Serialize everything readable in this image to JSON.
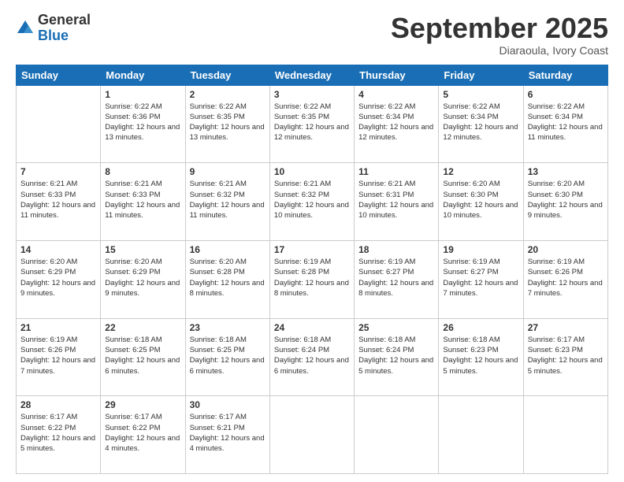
{
  "logo": {
    "general": "General",
    "blue": "Blue"
  },
  "header": {
    "month": "September 2025",
    "location": "Diaraoula, Ivory Coast"
  },
  "weekdays": [
    "Sunday",
    "Monday",
    "Tuesday",
    "Wednesday",
    "Thursday",
    "Friday",
    "Saturday"
  ],
  "weeks": [
    [
      {
        "day": "",
        "sunrise": "",
        "sunset": "",
        "daylight": ""
      },
      {
        "day": "1",
        "sunrise": "Sunrise: 6:22 AM",
        "sunset": "Sunset: 6:36 PM",
        "daylight": "Daylight: 12 hours and 13 minutes."
      },
      {
        "day": "2",
        "sunrise": "Sunrise: 6:22 AM",
        "sunset": "Sunset: 6:35 PM",
        "daylight": "Daylight: 12 hours and 13 minutes."
      },
      {
        "day": "3",
        "sunrise": "Sunrise: 6:22 AM",
        "sunset": "Sunset: 6:35 PM",
        "daylight": "Daylight: 12 hours and 12 minutes."
      },
      {
        "day": "4",
        "sunrise": "Sunrise: 6:22 AM",
        "sunset": "Sunset: 6:34 PM",
        "daylight": "Daylight: 12 hours and 12 minutes."
      },
      {
        "day": "5",
        "sunrise": "Sunrise: 6:22 AM",
        "sunset": "Sunset: 6:34 PM",
        "daylight": "Daylight: 12 hours and 12 minutes."
      },
      {
        "day": "6",
        "sunrise": "Sunrise: 6:22 AM",
        "sunset": "Sunset: 6:34 PM",
        "daylight": "Daylight: 12 hours and 11 minutes."
      }
    ],
    [
      {
        "day": "7",
        "sunrise": "Sunrise: 6:21 AM",
        "sunset": "Sunset: 6:33 PM",
        "daylight": "Daylight: 12 hours and 11 minutes."
      },
      {
        "day": "8",
        "sunrise": "Sunrise: 6:21 AM",
        "sunset": "Sunset: 6:33 PM",
        "daylight": "Daylight: 12 hours and 11 minutes."
      },
      {
        "day": "9",
        "sunrise": "Sunrise: 6:21 AM",
        "sunset": "Sunset: 6:32 PM",
        "daylight": "Daylight: 12 hours and 11 minutes."
      },
      {
        "day": "10",
        "sunrise": "Sunrise: 6:21 AM",
        "sunset": "Sunset: 6:32 PM",
        "daylight": "Daylight: 12 hours and 10 minutes."
      },
      {
        "day": "11",
        "sunrise": "Sunrise: 6:21 AM",
        "sunset": "Sunset: 6:31 PM",
        "daylight": "Daylight: 12 hours and 10 minutes."
      },
      {
        "day": "12",
        "sunrise": "Sunrise: 6:20 AM",
        "sunset": "Sunset: 6:30 PM",
        "daylight": "Daylight: 12 hours and 10 minutes."
      },
      {
        "day": "13",
        "sunrise": "Sunrise: 6:20 AM",
        "sunset": "Sunset: 6:30 PM",
        "daylight": "Daylight: 12 hours and 9 minutes."
      }
    ],
    [
      {
        "day": "14",
        "sunrise": "Sunrise: 6:20 AM",
        "sunset": "Sunset: 6:29 PM",
        "daylight": "Daylight: 12 hours and 9 minutes."
      },
      {
        "day": "15",
        "sunrise": "Sunrise: 6:20 AM",
        "sunset": "Sunset: 6:29 PM",
        "daylight": "Daylight: 12 hours and 9 minutes."
      },
      {
        "day": "16",
        "sunrise": "Sunrise: 6:20 AM",
        "sunset": "Sunset: 6:28 PM",
        "daylight": "Daylight: 12 hours and 8 minutes."
      },
      {
        "day": "17",
        "sunrise": "Sunrise: 6:19 AM",
        "sunset": "Sunset: 6:28 PM",
        "daylight": "Daylight: 12 hours and 8 minutes."
      },
      {
        "day": "18",
        "sunrise": "Sunrise: 6:19 AM",
        "sunset": "Sunset: 6:27 PM",
        "daylight": "Daylight: 12 hours and 8 minutes."
      },
      {
        "day": "19",
        "sunrise": "Sunrise: 6:19 AM",
        "sunset": "Sunset: 6:27 PM",
        "daylight": "Daylight: 12 hours and 7 minutes."
      },
      {
        "day": "20",
        "sunrise": "Sunrise: 6:19 AM",
        "sunset": "Sunset: 6:26 PM",
        "daylight": "Daylight: 12 hours and 7 minutes."
      }
    ],
    [
      {
        "day": "21",
        "sunrise": "Sunrise: 6:19 AM",
        "sunset": "Sunset: 6:26 PM",
        "daylight": "Daylight: 12 hours and 7 minutes."
      },
      {
        "day": "22",
        "sunrise": "Sunrise: 6:18 AM",
        "sunset": "Sunset: 6:25 PM",
        "daylight": "Daylight: 12 hours and 6 minutes."
      },
      {
        "day": "23",
        "sunrise": "Sunrise: 6:18 AM",
        "sunset": "Sunset: 6:25 PM",
        "daylight": "Daylight: 12 hours and 6 minutes."
      },
      {
        "day": "24",
        "sunrise": "Sunrise: 6:18 AM",
        "sunset": "Sunset: 6:24 PM",
        "daylight": "Daylight: 12 hours and 6 minutes."
      },
      {
        "day": "25",
        "sunrise": "Sunrise: 6:18 AM",
        "sunset": "Sunset: 6:24 PM",
        "daylight": "Daylight: 12 hours and 5 minutes."
      },
      {
        "day": "26",
        "sunrise": "Sunrise: 6:18 AM",
        "sunset": "Sunset: 6:23 PM",
        "daylight": "Daylight: 12 hours and 5 minutes."
      },
      {
        "day": "27",
        "sunrise": "Sunrise: 6:17 AM",
        "sunset": "Sunset: 6:23 PM",
        "daylight": "Daylight: 12 hours and 5 minutes."
      }
    ],
    [
      {
        "day": "28",
        "sunrise": "Sunrise: 6:17 AM",
        "sunset": "Sunset: 6:22 PM",
        "daylight": "Daylight: 12 hours and 5 minutes."
      },
      {
        "day": "29",
        "sunrise": "Sunrise: 6:17 AM",
        "sunset": "Sunset: 6:22 PM",
        "daylight": "Daylight: 12 hours and 4 minutes."
      },
      {
        "day": "30",
        "sunrise": "Sunrise: 6:17 AM",
        "sunset": "Sunset: 6:21 PM",
        "daylight": "Daylight: 12 hours and 4 minutes."
      },
      {
        "day": "",
        "sunrise": "",
        "sunset": "",
        "daylight": ""
      },
      {
        "day": "",
        "sunrise": "",
        "sunset": "",
        "daylight": ""
      },
      {
        "day": "",
        "sunrise": "",
        "sunset": "",
        "daylight": ""
      },
      {
        "day": "",
        "sunrise": "",
        "sunset": "",
        "daylight": ""
      }
    ]
  ]
}
